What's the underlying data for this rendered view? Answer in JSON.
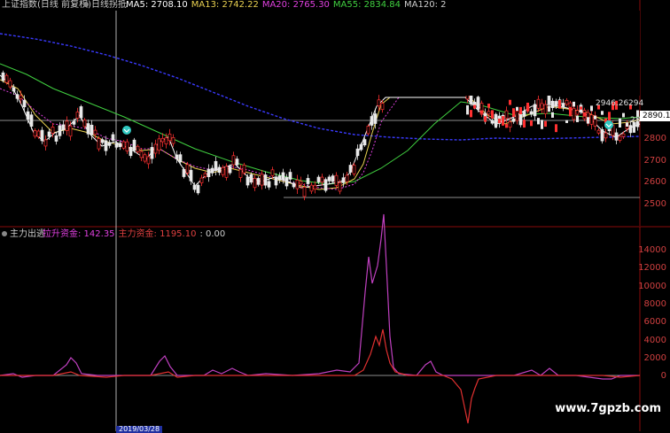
{
  "header": {
    "index_name": "上证指数",
    "period_label": "(日线 前复权)",
    "indicator_name": "日线拐抵",
    "ma": [
      {
        "label": "MA5:",
        "value": "2708.10",
        "color": "#ffffff"
      },
      {
        "label": "MA13:",
        "value": "2742.22",
        "color": "#e8d050"
      },
      {
        "label": "MA20:",
        "value": "2765.30",
        "color": "#e040e0"
      },
      {
        "label": "MA55:",
        "value": "2834.84",
        "color": "#40d040"
      },
      {
        "label": "MA120:",
        "value": "2",
        "color": "#cccccc"
      }
    ]
  },
  "subpanel": {
    "title": "主力出逃",
    "items": [
      {
        "label": "拉升资金:",
        "value": "142.35",
        "color": "#e040e0"
      },
      {
        "label": "主力资金:",
        "value": "1195.10",
        "color": "#e04040"
      },
      {
        "label": ":",
        "value": "0.00",
        "color": "#cccccc"
      }
    ]
  },
  "price_axis": {
    "ticks": [
      "2800",
      "2700",
      "2600",
      "2500"
    ],
    "current_tag": "2890.1",
    "callouts": [
      "2946.26",
      "294",
      "28"
    ]
  },
  "sub_axis": {
    "ticks": [
      "14000",
      "12000",
      "10000",
      "8000",
      "6000",
      "4000",
      "2000",
      "0"
    ]
  },
  "bottom_label": "2019/03/28",
  "watermark": "www.7gpzb.com",
  "colors": {
    "axis": "#d04040",
    "grid": "#8a0a0a",
    "up": "#ff3030",
    "down": "#e8e8e8",
    "ma5": "#ffffff",
    "ma13": "#e8d050",
    "ma20": "#e040e0",
    "ma55": "#40d040",
    "ma120": "#4040ff"
  }
}
